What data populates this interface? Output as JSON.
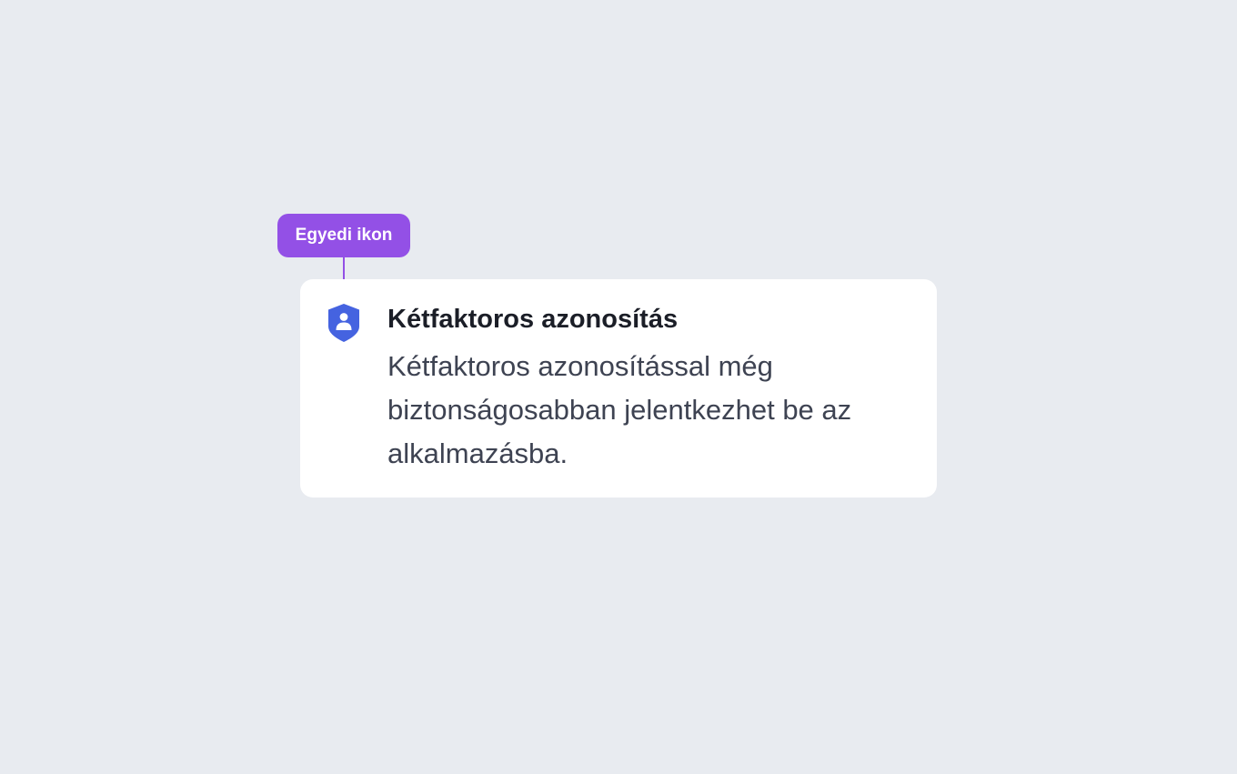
{
  "annotation": {
    "label": "Egyedi ikon"
  },
  "card": {
    "icon": "shield-user-icon",
    "title": "Kétfaktoros azonosítás",
    "description": "Kétfaktoros azonosítással még biztonságosabban jelentkezhet be az alkalmazásba."
  },
  "colors": {
    "background": "#e8ebf0",
    "annotation_accent": "#9350e6",
    "icon_blue": "#4563e0",
    "title_text": "#1b1e27",
    "body_text": "#3e4352",
    "card_background": "#ffffff"
  }
}
